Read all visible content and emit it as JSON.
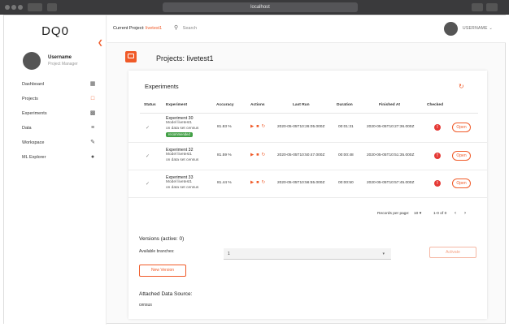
{
  "browser": {
    "url": "localhost"
  },
  "app": {
    "logo": "DQ0",
    "collapse_icon": "chevron-left"
  },
  "user": {
    "name": "Username",
    "role": "Project Manager",
    "top_name": "USERNAME"
  },
  "sidebar": {
    "items": [
      {
        "label": "Dashboard",
        "icon": "dashboard-icon"
      },
      {
        "label": "Projects",
        "icon": "folder-icon"
      },
      {
        "label": "Experiments",
        "icon": "bar-chart-icon"
      },
      {
        "label": "Data",
        "icon": "list-icon"
      },
      {
        "label": "Workspace",
        "icon": "edit-icon"
      },
      {
        "label": "ML Explorer",
        "icon": "compass-icon"
      }
    ]
  },
  "topbar": {
    "current_label": "Current Project:",
    "current_value": "livetest1",
    "search_placeholder": "Search"
  },
  "page": {
    "title": "Projects: livetest1"
  },
  "experiments": {
    "title": "Experiments",
    "columns": [
      "Status",
      "Experiment",
      "Accuracy",
      "Actions",
      "Last Run",
      "Duration",
      "Finished At",
      "Checked"
    ],
    "rows": [
      {
        "status": "✓",
        "name": "Experiment 30",
        "model": "Model livetest1",
        "dataset": "on data set census",
        "badge": "recommended",
        "accuracy": "81.83 %",
        "last_run": "2020-05-05T10:26:05.000Z",
        "duration": "00:01:31",
        "finished": "2020-05-05T10:27:36.000Z",
        "open": "Open"
      },
      {
        "status": "✓",
        "name": "Experiment 32",
        "model": "Model livetest1",
        "dataset": "on data set census",
        "badge": "",
        "accuracy": "81.59 %",
        "last_run": "2020-05-05T10:50:47.000Z",
        "duration": "00:00:48",
        "finished": "2020-05-05T10:51:35.000Z",
        "open": "Open"
      },
      {
        "status": "✓",
        "name": "Experiment 33",
        "model": "Model livetest1",
        "dataset": "on data set census",
        "badge": "",
        "accuracy": "81.44 %",
        "last_run": "2020-05-05T10:56:55.000Z",
        "duration": "00:00:50",
        "finished": "2020-05-05T10:57:45.000Z",
        "open": "Open"
      }
    ],
    "pager": {
      "label": "Records per page:",
      "per_page": "10",
      "range": "1-0 of 0"
    }
  },
  "versions": {
    "title": "Versions (active: 0)",
    "branches_label": "Available branches:",
    "branch_value": "1",
    "activate": "Activate",
    "new_version": "New Version"
  },
  "datasource": {
    "title": "Attached Data Source:",
    "value": "census"
  },
  "colors": {
    "accent": "#f05a28",
    "badge": "#43a047",
    "alert": "#e53935"
  }
}
